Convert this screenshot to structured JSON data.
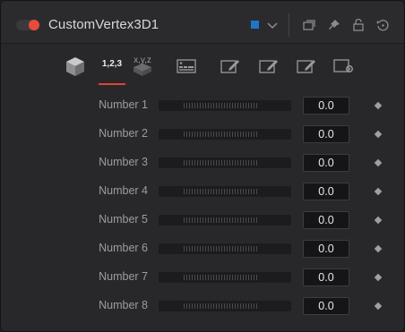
{
  "header": {
    "title": "CustomVertex3D1",
    "swatch_color": "#1e76c9",
    "accent_color": "#e64b3c",
    "icons": [
      "chevron-down-icon",
      "versions-icon",
      "pin-icon",
      "lock-icon",
      "reset-icon"
    ]
  },
  "tabs": {
    "items": [
      {
        "name": "controls-tab",
        "icon": "cube-icon"
      },
      {
        "name": "numbers-tab",
        "label": "1,2,3",
        "active": true
      },
      {
        "name": "positions-tab",
        "label": "x,y,z"
      },
      {
        "name": "luts-tab",
        "icon": "image-icon"
      },
      {
        "name": "vertex-tab",
        "icon": "edit-icon"
      },
      {
        "name": "setup-tab",
        "icon": "edit-icon"
      },
      {
        "name": "intermediate-tab",
        "icon": "edit-icon"
      },
      {
        "name": "settings-tab",
        "icon": "settings-icon"
      }
    ],
    "active_color": "#e6403a"
  },
  "rows": [
    {
      "label": "Number 1",
      "value": "0.0"
    },
    {
      "label": "Number 2",
      "value": "0.0"
    },
    {
      "label": "Number 3",
      "value": "0.0"
    },
    {
      "label": "Number 4",
      "value": "0.0"
    },
    {
      "label": "Number 5",
      "value": "0.0"
    },
    {
      "label": "Number 6",
      "value": "0.0"
    },
    {
      "label": "Number 7",
      "value": "0.0"
    },
    {
      "label": "Number 8",
      "value": "0.0"
    }
  ]
}
